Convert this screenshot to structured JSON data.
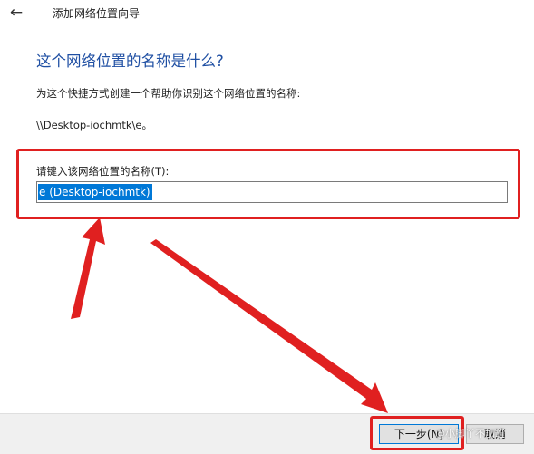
{
  "window": {
    "title": "添加网络位置向导",
    "back_icon": "←"
  },
  "main": {
    "heading": "这个网络位置的名称是什么?",
    "instruction": "为这个快捷方式创建一个帮助你识别这个网络位置的名称:",
    "address": "\\\\Desktop-iochmtk\\e。",
    "name_label": "请键入该网络位置的名称(T):",
    "name_value": "e (Desktop-iochmtk)"
  },
  "footer": {
    "next_label": "下一步(N)",
    "cancel_label": "取消"
  },
  "watermark": "@小脚丫不加班",
  "colors": {
    "heading": "#1f4fa3",
    "selection": "#0078d7",
    "annotation": "#e02020",
    "footer_bg": "#f0f0f0"
  }
}
